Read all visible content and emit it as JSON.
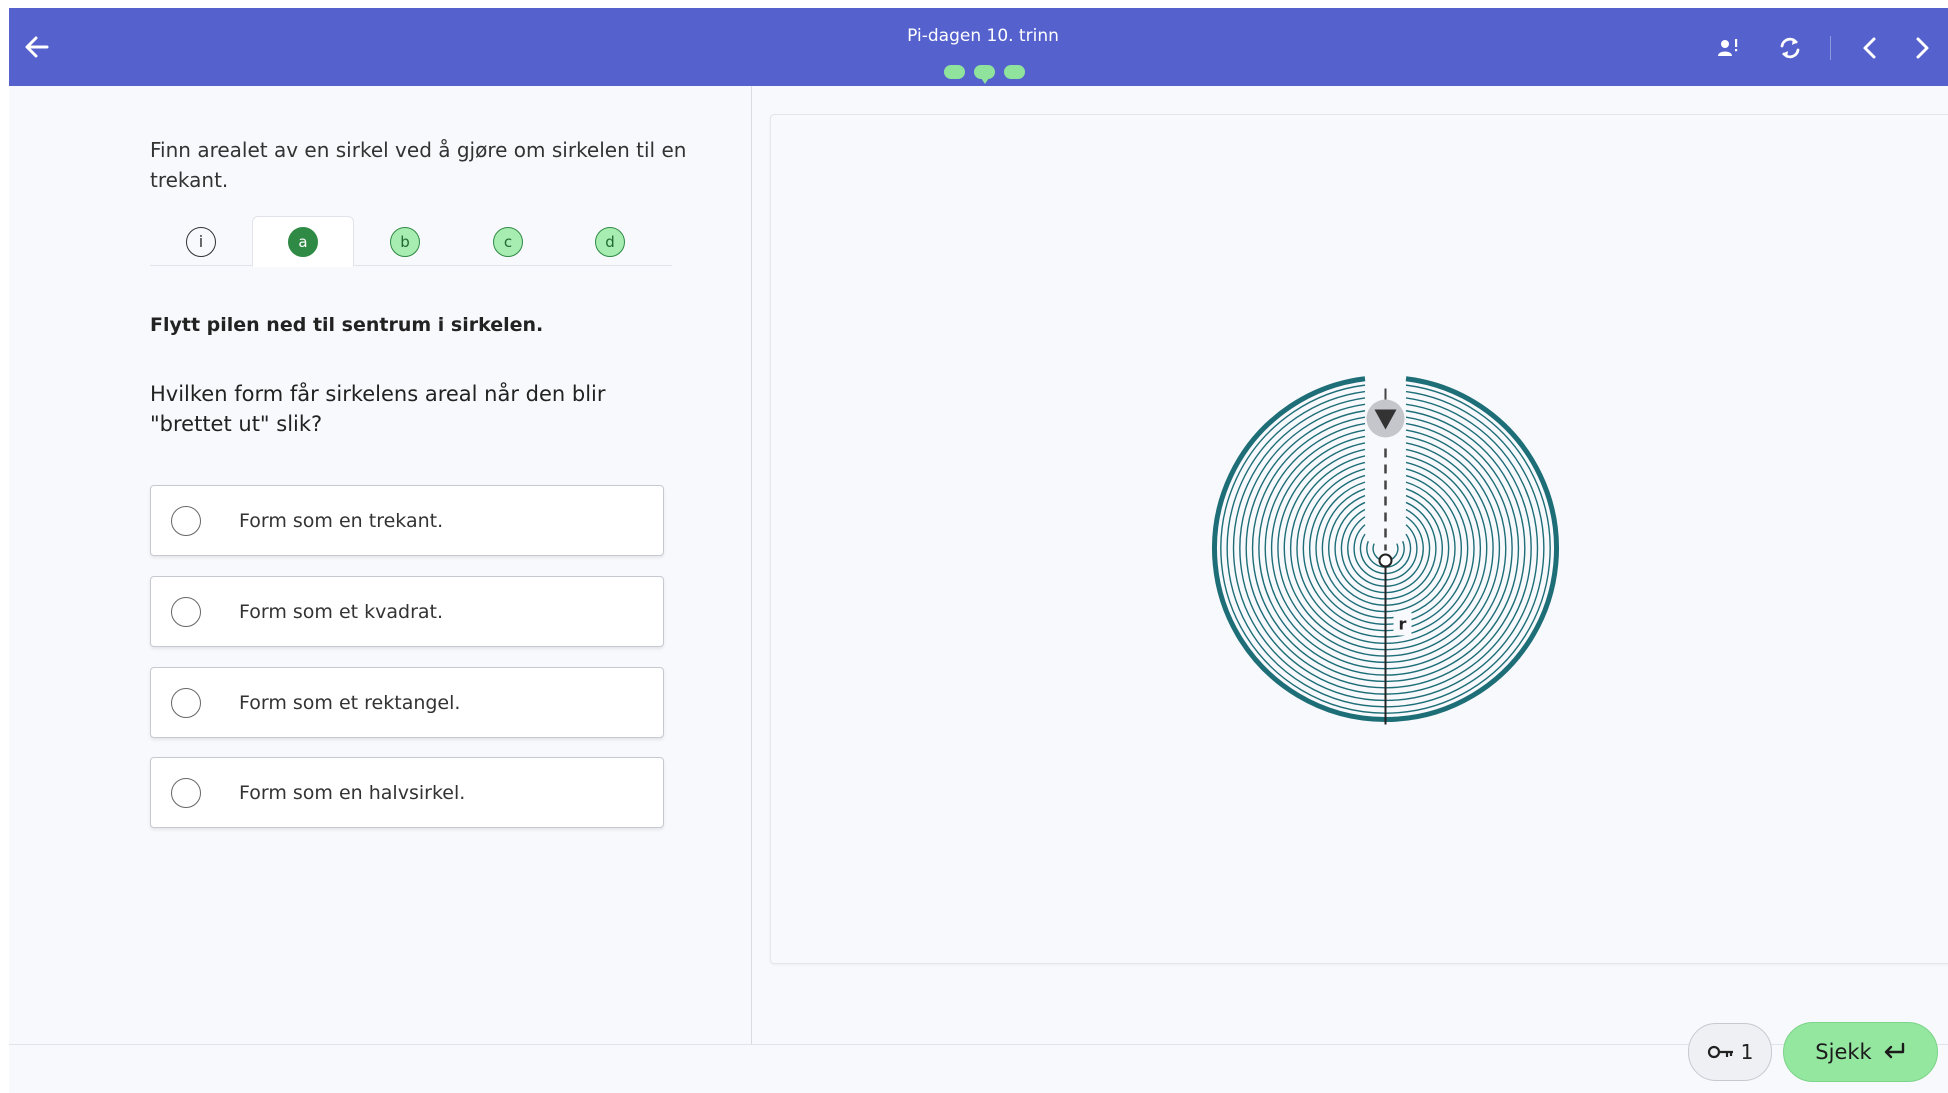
{
  "header": {
    "title": "Pi-dagen 10. trinn",
    "progress": {
      "total": 3,
      "current": 2
    },
    "icons": [
      "back-arrow-icon",
      "user-hint-icon",
      "refresh-icon",
      "chevron-left-icon",
      "chevron-right-icon"
    ]
  },
  "left": {
    "intro": "Finn arealet av en sirkel ved å gjøre om sirkelen til en trekant.",
    "tabs": [
      {
        "label": "i",
        "state": "info"
      },
      {
        "label": "a",
        "state": "active"
      },
      {
        "label": "b",
        "state": "inactive"
      },
      {
        "label": "c",
        "state": "inactive"
      },
      {
        "label": "d",
        "state": "inactive"
      }
    ],
    "task_label": "Flytt pilen ned til sentrum i sirkelen.",
    "question": "Hvilken form får sirkelens areal når den blir \"brettet ut\" slik?",
    "options": [
      {
        "label": "Form som en trekant.",
        "selected": false
      },
      {
        "label": "Form som et kvadrat.",
        "selected": false
      },
      {
        "label": "Form som et rektangel.",
        "selected": false
      },
      {
        "label": "Form som en halvsirkel.",
        "selected": false
      }
    ]
  },
  "figure": {
    "radius_label": "r",
    "ring_color": "#1e6e78",
    "icons": [
      "arrow-handle-icon",
      "center-point-icon"
    ]
  },
  "footer": {
    "hint_count": "1",
    "check_label": "Sjekk",
    "icons": [
      "key-icon",
      "enter-icon"
    ]
  },
  "colors": {
    "header_bg": "#5561cc",
    "progress_dot": "#8fe39c",
    "tab_active": "#2f8a45",
    "tab_inactive": "#a7ecb1",
    "check_button": "#94e79f"
  }
}
